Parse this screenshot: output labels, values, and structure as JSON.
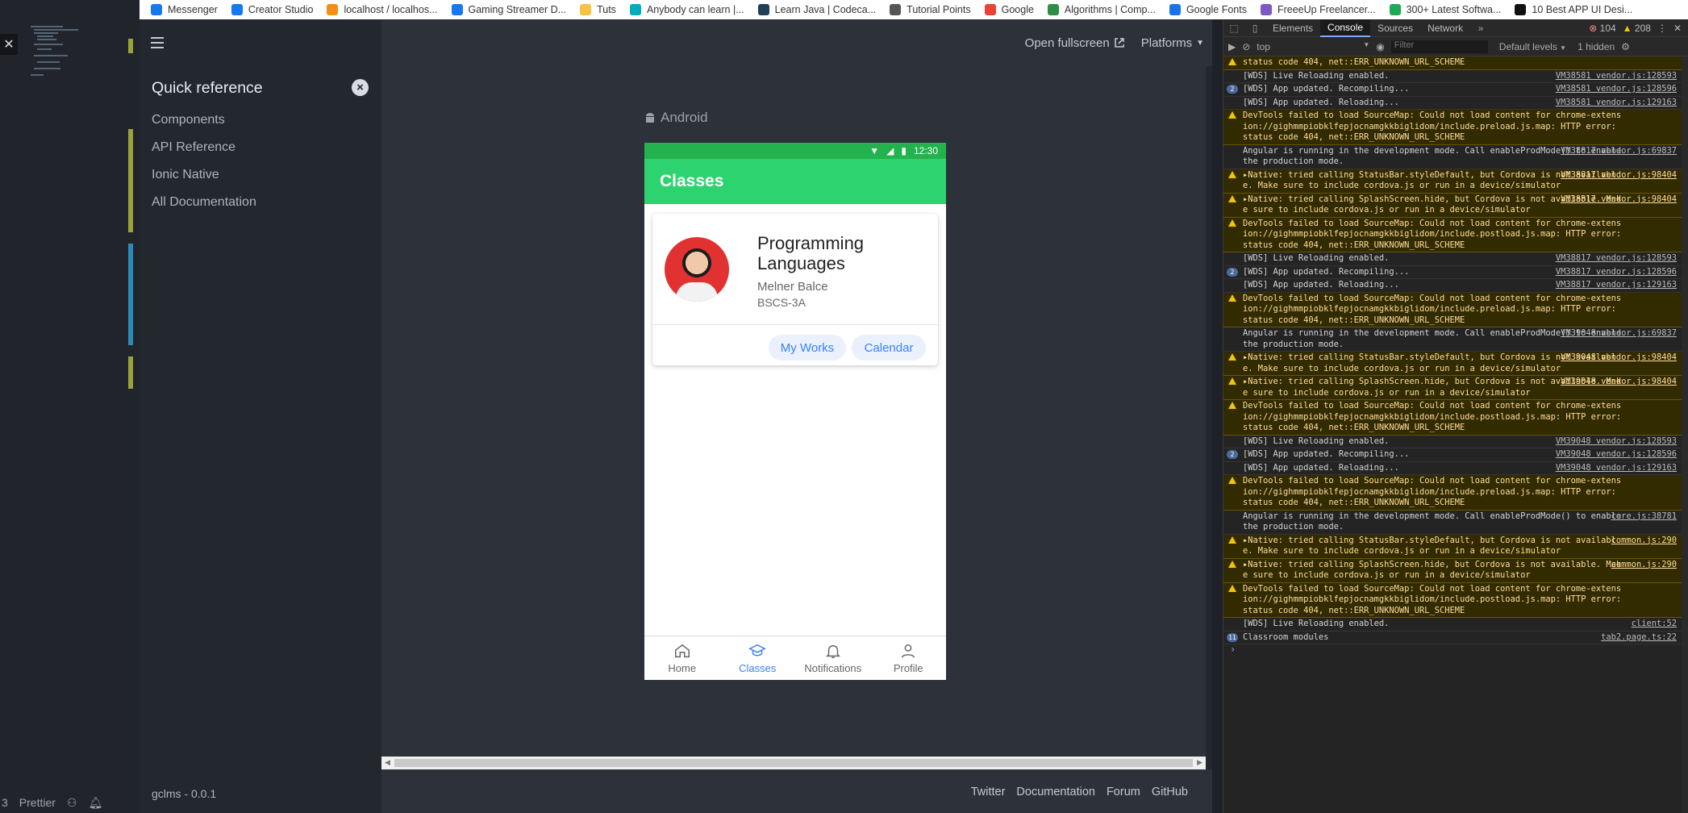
{
  "bookmarks": [
    {
      "label": "Messenger",
      "icon": "messenger-icon",
      "color": "#1877f2"
    },
    {
      "label": "Creator Studio",
      "icon": "facebook-icon",
      "color": "#1877f2"
    },
    {
      "label": "localhost / localhos...",
      "icon": "phpmyadmin-icon",
      "color": "#f29111"
    },
    {
      "label": "Gaming Streamer D...",
      "icon": "facebook-icon",
      "color": "#1877f2"
    },
    {
      "label": "Tuts",
      "icon": "folder-icon",
      "color": "#f6c343"
    },
    {
      "label": "Anybody can learn |...",
      "icon": "code-org-icon",
      "color": "#00adbc"
    },
    {
      "label": "Learn Java | Codeca...",
      "icon": "codecademy-icon",
      "color": "#1f4056"
    },
    {
      "label": "Tutorial Points",
      "icon": "tutorialspoint-icon",
      "color": "#555555"
    },
    {
      "label": "Google",
      "icon": "google-icon",
      "color": "#ea4335"
    },
    {
      "label": "Algorithms | Comp...",
      "icon": "geeks-icon",
      "color": "#2f8d46"
    },
    {
      "label": "Google Fonts",
      "icon": "google-fonts-icon",
      "color": "#1a73e8"
    },
    {
      "label": "FreeeUp Freelancer...",
      "icon": "freeup-icon",
      "color": "#7e57c2"
    },
    {
      "label": "300+ Latest Softwa...",
      "icon": "check-icon",
      "color": "#1faa59"
    },
    {
      "label": "10 Best APP UI Desi...",
      "icon": "medium-icon",
      "color": "#111111"
    }
  ],
  "editor": {
    "status_items": [
      "3",
      "Prettier"
    ]
  },
  "lab": {
    "sidebar": {
      "title": "Quick reference",
      "links": [
        "Components",
        "API Reference",
        "Ionic Native",
        "All Documentation"
      ],
      "version": "gclms - 0.0.1"
    },
    "topbar": {
      "fullscreen": "Open fullscreen",
      "platforms": "Platforms"
    },
    "platform_label": "Android",
    "footer_links": [
      "Twitter",
      "Documentation",
      "Forum",
      "GitHub"
    ]
  },
  "phone": {
    "status_time": "12:30",
    "toolbar_title": "Classes",
    "card": {
      "title": "Programming Languages",
      "teacher": "Melner Balce",
      "section": "BSCS-3A",
      "buttons": [
        "My Works",
        "Calendar"
      ]
    },
    "tabs": [
      {
        "label": "Home",
        "icon": "home-icon",
        "active": false
      },
      {
        "label": "Classes",
        "icon": "school-icon",
        "active": true
      },
      {
        "label": "Notifications",
        "icon": "bell-icon",
        "active": false
      },
      {
        "label": "Profile",
        "icon": "person-icon",
        "active": false
      }
    ]
  },
  "devtools": {
    "tabs": [
      "Elements",
      "Console",
      "Sources",
      "Network"
    ],
    "active_tab": "Console",
    "error_count": "104",
    "warning_count": "208",
    "context": "top",
    "filter_placeholder": "Filter",
    "levels": "Default levels",
    "hidden": "1 hidden",
    "messages": [
      {
        "type": "warn",
        "text": "status code 404, net::ERR_UNKNOWN_URL_SCHEME",
        "src": ""
      },
      {
        "type": "log",
        "text": "[WDS] Live Reloading enabled.",
        "src": "VM38581 vendor.js:128593"
      },
      {
        "type": "count",
        "count": "2",
        "text": "[WDS] App updated. Recompiling...",
        "src": "VM38581 vendor.js:128596"
      },
      {
        "type": "log",
        "text": "[WDS] App updated. Reloading...",
        "src": "VM38581 vendor.js:129163"
      },
      {
        "type": "warn",
        "text": "DevTools failed to load SourceMap: Could not load content for chrome-extension://gighmmpiobklfepjocnamgkkbiglidom/include.preload.js.map: HTTP error: status code 404, net::ERR_UNKNOWN_URL_SCHEME",
        "src": ""
      },
      {
        "type": "log",
        "text": "Angular is running in the development mode. Call enableProdMode() to enable the production mode.",
        "src": "VM38817 vendor.js:69837"
      },
      {
        "type": "warn",
        "text": "▸Native: tried calling StatusBar.styleDefault, but Cordova is not available. Make sure to include cordova.js or run in a device/simulator",
        "src": "VM38817 vendor.js:98404"
      },
      {
        "type": "warn",
        "text": "▸Native: tried calling SplashScreen.hide, but Cordova is not available. Make sure to include cordova.js or run in a device/simulator",
        "src": "VM38817 vendor.js:98404"
      },
      {
        "type": "warn",
        "text": "DevTools failed to load SourceMap: Could not load content for chrome-extension://gighmmpiobklfepjocnamgkkbiglidom/include.postload.js.map: HTTP error: status code 404, net::ERR_UNKNOWN_URL_SCHEME",
        "src": ""
      },
      {
        "type": "log",
        "text": "[WDS] Live Reloading enabled.",
        "src": "VM38817 vendor.js:128593"
      },
      {
        "type": "count",
        "count": "2",
        "text": "[WDS] App updated. Recompiling...",
        "src": "VM38817 vendor.js:128596"
      },
      {
        "type": "log",
        "text": "[WDS] App updated. Reloading...",
        "src": "VM38817 vendor.js:129163"
      },
      {
        "type": "warn",
        "text": "DevTools failed to load SourceMap: Could not load content for chrome-extension://gighmmpiobklfepjocnamgkkbiglidom/include.preload.js.map: HTTP error: status code 404, net::ERR_UNKNOWN_URL_SCHEME",
        "src": ""
      },
      {
        "type": "log",
        "text": "Angular is running in the development mode. Call enableProdMode() to enable the production mode.",
        "src": "VM39048 vendor.js:69837"
      },
      {
        "type": "warn",
        "text": "▸Native: tried calling StatusBar.styleDefault, but Cordova is not available. Make sure to include cordova.js or run in a device/simulator",
        "src": "VM39048 vendor.js:98404"
      },
      {
        "type": "warn",
        "text": "▸Native: tried calling SplashScreen.hide, but Cordova is not available. Make sure to include cordova.js or run in a device/simulator",
        "src": "VM39048 vendor.js:98404"
      },
      {
        "type": "warn",
        "text": "DevTools failed to load SourceMap: Could not load content for chrome-extension://gighmmpiobklfepjocnamgkkbiglidom/include.postload.js.map: HTTP error: status code 404, net::ERR_UNKNOWN_URL_SCHEME",
        "src": ""
      },
      {
        "type": "log",
        "text": "[WDS] Live Reloading enabled.",
        "src": "VM39048 vendor.js:128593"
      },
      {
        "type": "count",
        "count": "2",
        "text": "[WDS] App updated. Recompiling...",
        "src": "VM39048 vendor.js:128596"
      },
      {
        "type": "log",
        "text": "[WDS] App updated. Reloading...",
        "src": "VM39048 vendor.js:129163"
      },
      {
        "type": "warn",
        "text": "DevTools failed to load SourceMap: Could not load content for chrome-extension://gighmmpiobklfepjocnamgkkbiglidom/include.preload.js.map: HTTP error: status code 404, net::ERR_UNKNOWN_URL_SCHEME",
        "src": ""
      },
      {
        "type": "log",
        "text": "Angular is running in the development mode. Call enableProdMode() to enable the production mode.",
        "src": "core.js:38781"
      },
      {
        "type": "warn",
        "text": "▸Native: tried calling StatusBar.styleDefault, but Cordova is not available. Make sure to include cordova.js or run in a device/simulator",
        "src": "common.js:290"
      },
      {
        "type": "warn",
        "text": "▸Native: tried calling SplashScreen.hide, but Cordova is not available. Make sure to include cordova.js or run in a device/simulator",
        "src": "common.js:290"
      },
      {
        "type": "warn",
        "text": "DevTools failed to load SourceMap: Could not load content for chrome-extension://gighmmpiobklfepjocnamgkkbiglidom/include.postload.js.map: HTTP error: status code 404, net::ERR_UNKNOWN_URL_SCHEME",
        "src": ""
      },
      {
        "type": "log",
        "text": "[WDS] Live Reloading enabled.",
        "src": "client:52"
      },
      {
        "type": "count",
        "count": "11",
        "text": "Classroom modules",
        "src": "tab2.page.ts:22"
      }
    ]
  }
}
